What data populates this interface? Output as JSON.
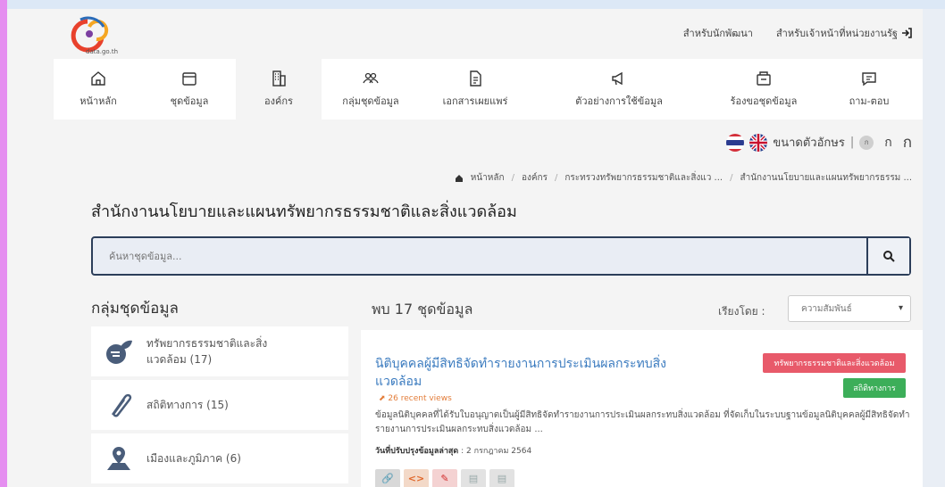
{
  "header": {
    "logo_text": "data.go.th",
    "links": [
      "สำหรับนักพัฒนา",
      "สำหรับเจ้าหน้าที่หน่วยงานรัฐ"
    ]
  },
  "nav": {
    "items": [
      {
        "label": "หน้าหลัก",
        "icon": "home-icon"
      },
      {
        "label": "ชุดข้อมูล",
        "icon": "folder-icon"
      },
      {
        "label": "องค์กร",
        "icon": "building-icon"
      },
      {
        "label": "กลุ่มชุดข้อมูล",
        "icon": "group-icon"
      },
      {
        "label": "เอกสารเผยแพร่",
        "icon": "document-icon"
      },
      {
        "label": "ตัวอย่างการใช้ข้อมูล",
        "icon": "megaphone-icon"
      },
      {
        "label": "ร้องขอชุดข้อมูล",
        "icon": "request-icon"
      },
      {
        "label": "ถาม-ตอบ",
        "icon": "chat-icon"
      }
    ],
    "active": "องค์กร"
  },
  "utility": {
    "font_size_label": "ขนาดตัวอักษร",
    "font_small": "ก",
    "font_medium": "ก",
    "font_large": "ก"
  },
  "breadcrumb": {
    "items": [
      "หน้าหลัก",
      "องค์กร",
      "กระทรวงทรัพยากรธรรมชาติและสิ่งแว ...",
      "สำนักงานนโยบายและแผนทรัพยากรธรรม ..."
    ]
  },
  "page_title": "สำนักงานนโยบายและแผนทรัพยากรธรรมชาติและสิ่งแวดล้อม",
  "search": {
    "placeholder": "ค้นหาชุดข้อมูล..."
  },
  "groups": {
    "title": "กลุ่มชุดข้อมูล",
    "items": [
      {
        "label": "ทรัพยากรธรรมชาติและสิ่งแวดล้อม (17)"
      },
      {
        "label": "สถิติทางการ (15)"
      },
      {
        "label": "เมืองและภูมิภาค (6)"
      }
    ]
  },
  "results": {
    "found_text": "พบ 17 ชุดข้อมูล",
    "sort_label": "เรียงโดย :",
    "sort_value": "ความสัมพันธ์",
    "first": {
      "title": "นิติบุคคลผู้มีสิทธิจัดทำรายงานการประเมินผลกระทบสิ่งแวดล้อม",
      "views": "26 recent views",
      "description": "ข้อมูลนิติบุคคลที่ได้รับใบอนุญาตเป็นผู้มีสิทธิจัดทำรายงานการประเมินผลกระทบสิ่งแวดล้อม ที่จัดเก็บในระบบฐานข้อมูลนิติบุคคลผู้มีสิทธิจัดทำรายงานการประเมินผลกระทบสิ่งแวดล้อม ...",
      "updated_label": "วันที่ปรับปรุงข้อมูลล่าสุด",
      "updated_value": ": 2 กรกฎาคม 2564",
      "badges": [
        "ทรัพยากรธรรมชาติและสิ่งแวดล้อม",
        "สถิติทางการ"
      ],
      "formats": [
        "link-icon",
        "api-icon",
        "pdf-icon",
        "csv-icon",
        "file-icon"
      ]
    }
  },
  "colors": {
    "nav_bg": "#ffffff",
    "page_bg": "#f4f4f4",
    "link": "#3b7bbf",
    "badge_red": "#e85a6a",
    "badge_green": "#3cae59",
    "search_border": "#2c3e5a"
  }
}
